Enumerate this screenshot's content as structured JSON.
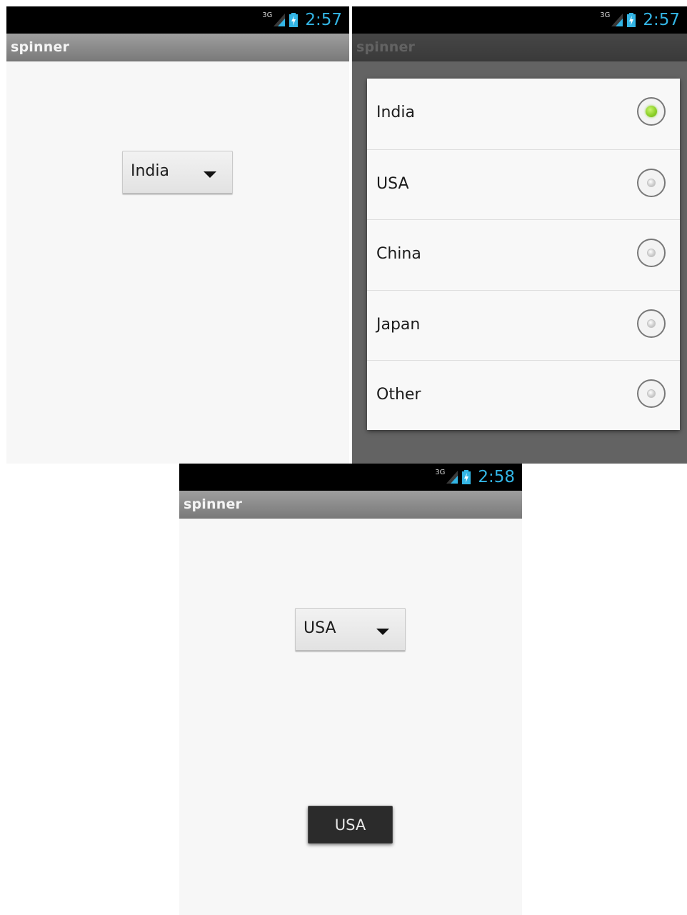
{
  "screen1": {
    "status": {
      "network": "3G",
      "time": "2:57"
    },
    "title": "spinner",
    "spinner_value": "India"
  },
  "screen2": {
    "status": {
      "network": "3G",
      "time": "2:57"
    },
    "title": "spinner",
    "dialog": {
      "options": [
        {
          "label": "India",
          "selected": true
        },
        {
          "label": "USA",
          "selected": false
        },
        {
          "label": "China",
          "selected": false
        },
        {
          "label": "Japan",
          "selected": false
        },
        {
          "label": "Other",
          "selected": false
        }
      ]
    }
  },
  "screen3": {
    "status": {
      "network": "3G",
      "time": "2:58"
    },
    "title": "spinner",
    "spinner_value": "USA",
    "toast": "USA"
  },
  "colors": {
    "clock": "#33b5e5",
    "radio_selected": "#8ed12a"
  }
}
